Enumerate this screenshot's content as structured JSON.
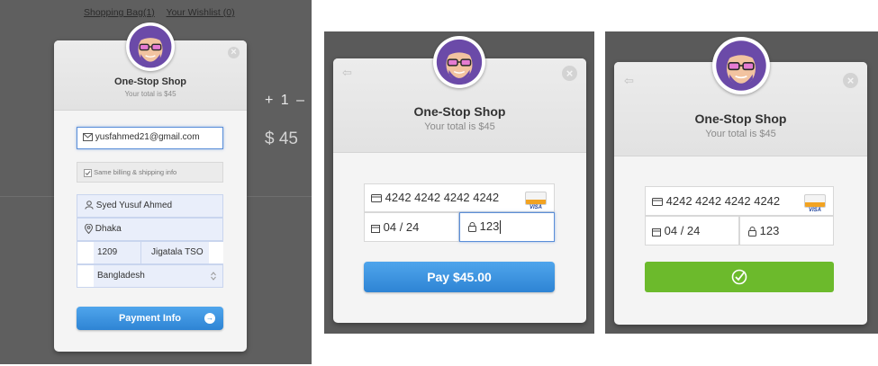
{
  "shop": {
    "name": "One-Stop Shop",
    "total": "Your total is $45"
  },
  "background": {
    "shopping_bag_link": "Shopping Bag(1)",
    "wishlist_link": "Your Wishlist (0)",
    "quantity": "+ 1 –",
    "price": "$ 45"
  },
  "step1": {
    "email": "yusfahmed21@gmail.com",
    "same_billing": "Same billing & shipping info",
    "name": "Syed Yusuf Ahmed",
    "city": "Dhaka",
    "zip": "1209",
    "area": "Jigatala TSO",
    "country": "Bangladesh",
    "button": "Payment Info",
    "button_arrow": "→"
  },
  "step2": {
    "card_number": "4242 4242 4242 4242",
    "card_brand": "VISA",
    "expiry": "04 / 24",
    "cvc": "123",
    "pay_button": "Pay $45.00"
  },
  "step3": {
    "card_number": "4242 4242 4242 4242",
    "card_brand": "VISA",
    "expiry": "04 / 24",
    "cvc": "123"
  },
  "icons": {
    "close": "×",
    "back": "⇦"
  },
  "colors": {
    "accent_blue": "#2e84d4",
    "success_green": "#6cba2c",
    "avatar_purple": "#6b4aa8"
  }
}
